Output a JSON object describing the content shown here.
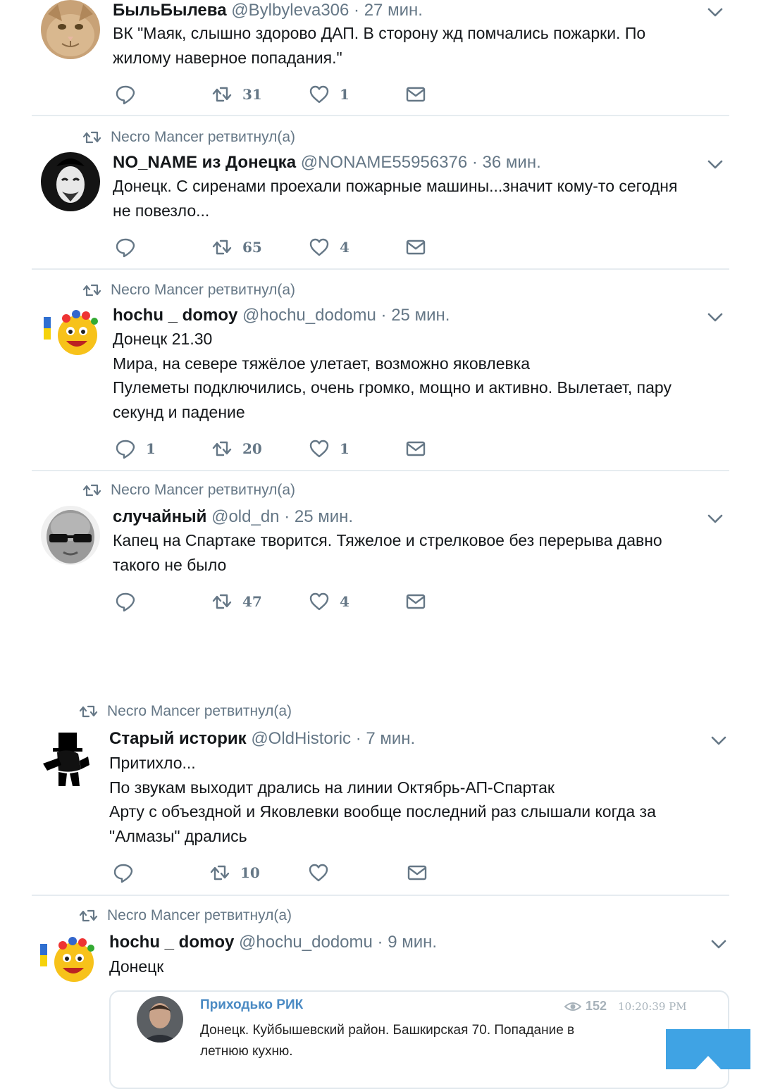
{
  "retweet_text": "Necro Mancer ретвитнул(а)",
  "tweets": [
    {
      "name": "БыльБылева",
      "handle": "@Bylbyleva306",
      "time": "27 мин.",
      "lines": [
        "ВК \"Маяк, слышно здорово ДАП. В сторону жд помчались пожарки. По",
        "жилому наверное попадания.\""
      ],
      "replies": "",
      "retweets": "31",
      "likes": "1"
    },
    {
      "name": "NO_NAME из Донецка",
      "handle": "@NONAME55956376",
      "time": "36 мин.",
      "lines": [
        "Донецк.  С сиренами проехали пожарные машины...значит кому-то сегодня",
        "не повезло..."
      ],
      "replies": "",
      "retweets": "65",
      "likes": "4"
    },
    {
      "name": "hochu _ domoy",
      "handle": "@hochu_dodomu",
      "time": "25 мин.",
      "lines": [
        "Донецк 21.30",
        "Мира, на севере тяжёлое улетает, возможно яковлевка",
        "Пулеметы подключились, очень громко, мощно и активно. Вылетает, пару",
        "секунд и падение"
      ],
      "replies": "1",
      "retweets": "20",
      "likes": "1"
    },
    {
      "name": "случайный",
      "handle": "@old_dn",
      "time": "25 мин.",
      "lines": [
        "Капец на Спартаке творится. Тяжелое и стрелковое без перерыва давно",
        "такого не было"
      ],
      "replies": "",
      "retweets": "47",
      "likes": "4"
    },
    {
      "name": "Старый историк",
      "handle": "@OldHistoric",
      "time": "7 мин.",
      "lines": [
        "Притихло...",
        "По звукам выходит дрались на линии Октябрь-АП-Спартак",
        "Арту с объездной и Яковлевки вообще последний раз слышали когда за",
        "\"Алмазы\" дрались"
      ],
      "replies": "",
      "retweets": "10",
      "likes": ""
    },
    {
      "name": "hochu _ domoy",
      "handle": "@hochu_dodomu",
      "time": "9 мин.",
      "lines": [
        "Донецк"
      ]
    }
  ],
  "quote": {
    "name": "Приходько РИК",
    "views": "152",
    "time": "10:20:39 PM",
    "lines": [
      "Донецк. Куйбышевский район. Башкирская 70. Попадание в",
      "летнюю кухню."
    ]
  },
  "colors": {
    "accent": "#3fa3e4",
    "muted": "#657786",
    "separator": "#e6ecf0"
  }
}
